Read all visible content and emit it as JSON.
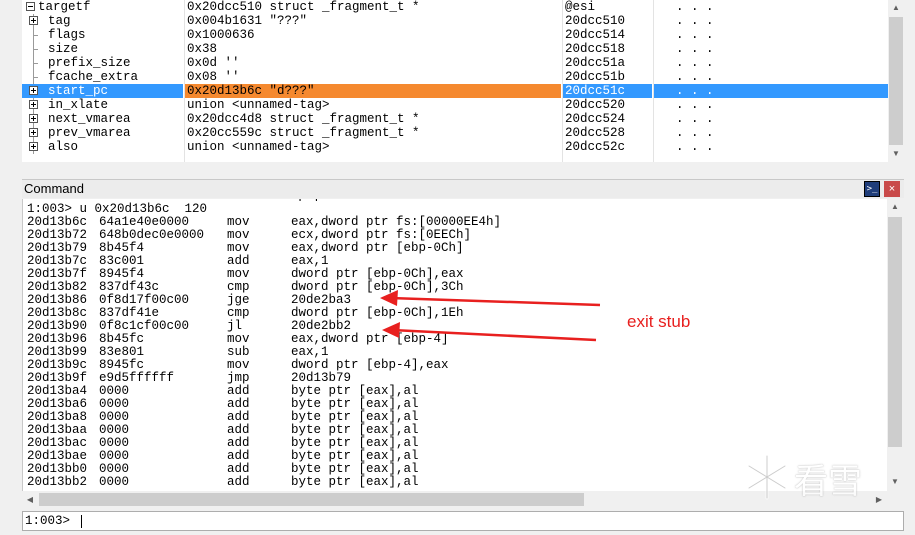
{
  "locals": {
    "rows": [
      {
        "indent": 0,
        "expander": "minus",
        "name": "targetf",
        "value": "0x20dcc510 struct _fragment_t *",
        "location": "@esi",
        "extra": ". . ."
      },
      {
        "indent": 1,
        "expander": "plus",
        "name": "tag",
        "value": "0x004b1631 \"???\"",
        "location": "20dcc510",
        "extra": ". . ."
      },
      {
        "indent": 1,
        "expander": "none",
        "name": "flags",
        "value": "0x1000636",
        "location": "20dcc514",
        "extra": ". . ."
      },
      {
        "indent": 1,
        "expander": "none",
        "name": "size",
        "value": "0x38",
        "location": "20dcc518",
        "extra": ". . ."
      },
      {
        "indent": 1,
        "expander": "none",
        "name": "prefix_size",
        "value": "0x0d ''",
        "location": "20dcc51a",
        "extra": ". . ."
      },
      {
        "indent": 1,
        "expander": "none",
        "name": "fcache_extra",
        "value": "0x08 ''",
        "location": "20dcc51b",
        "extra": ". . ."
      },
      {
        "indent": 1,
        "expander": "plus",
        "name": "start_pc",
        "value": "0x20d13b6c \"d???\"",
        "location": "20dcc51c",
        "extra": ". . .",
        "selected": true
      },
      {
        "indent": 1,
        "expander": "plus",
        "name": "in_xlate",
        "value": "union <unnamed-tag>",
        "location": "20dcc520",
        "extra": ". . ."
      },
      {
        "indent": 1,
        "expander": "plus",
        "name": "next_vmarea",
        "value": "0x20dcc4d8 struct _fragment_t *",
        "location": "20dcc524",
        "extra": ". . ."
      },
      {
        "indent": 1,
        "expander": "plus",
        "name": "prev_vmarea",
        "value": "0x20cc559c struct _fragment_t *",
        "location": "20dcc528",
        "extra": ". . ."
      },
      {
        "indent": 1,
        "expander": "plus",
        "name": "also",
        "value": "union <unnamed-tag>",
        "location": "20dcc52c",
        "extra": ". . ."
      }
    ]
  },
  "command": {
    "title": "Command",
    "console_icon": ">_",
    "close_icon": "×",
    "partial_line": "                                    [ ]",
    "lines": [
      {
        "addr": "1:003> u 0x20d13b6c  120",
        "bytes": "",
        "mnem": "",
        "ops": ""
      },
      {
        "addr": "20d13b6c",
        "bytes": "64a1e40e0000",
        "mnem": "mov",
        "ops": "eax,dword ptr fs:[00000EE4h]"
      },
      {
        "addr": "20d13b72",
        "bytes": "648b0dec0e0000",
        "mnem": "mov",
        "ops": "ecx,dword ptr fs:[0EECh]"
      },
      {
        "addr": "20d13b79",
        "bytes": "8b45f4",
        "mnem": "mov",
        "ops": "eax,dword ptr [ebp-0Ch]"
      },
      {
        "addr": "20d13b7c",
        "bytes": "83c001",
        "mnem": "add",
        "ops": "eax,1"
      },
      {
        "addr": "20d13b7f",
        "bytes": "8945f4",
        "mnem": "mov",
        "ops": "dword ptr [ebp-0Ch],eax"
      },
      {
        "addr": "20d13b82",
        "bytes": "837df43c",
        "mnem": "cmp",
        "ops": "dword ptr [ebp-0Ch],3Ch"
      },
      {
        "addr": "20d13b86",
        "bytes": "0f8d17f00c00",
        "mnem": "jge",
        "ops": "20de2ba3"
      },
      {
        "addr": "20d13b8c",
        "bytes": "837df41e",
        "mnem": "cmp",
        "ops": "dword ptr [ebp-0Ch],1Eh"
      },
      {
        "addr": "20d13b90",
        "bytes": "0f8c1cf00c00",
        "mnem": "jl",
        "ops": "20de2bb2"
      },
      {
        "addr": "20d13b96",
        "bytes": "8b45fc",
        "mnem": "mov",
        "ops": "eax,dword ptr [ebp-4]"
      },
      {
        "addr": "20d13b99",
        "bytes": "83e801",
        "mnem": "sub",
        "ops": "eax,1"
      },
      {
        "addr": "20d13b9c",
        "bytes": "8945fc",
        "mnem": "mov",
        "ops": "dword ptr [ebp-4],eax"
      },
      {
        "addr": "20d13b9f",
        "bytes": "e9d5ffffff",
        "mnem": "jmp",
        "ops": "20d13b79"
      },
      {
        "addr": "20d13ba4",
        "bytes": "0000",
        "mnem": "add",
        "ops": "byte ptr [eax],al"
      },
      {
        "addr": "20d13ba6",
        "bytes": "0000",
        "mnem": "add",
        "ops": "byte ptr [eax],al"
      },
      {
        "addr": "20d13ba8",
        "bytes": "0000",
        "mnem": "add",
        "ops": "byte ptr [eax],al"
      },
      {
        "addr": "20d13baa",
        "bytes": "0000",
        "mnem": "add",
        "ops": "byte ptr [eax],al"
      },
      {
        "addr": "20d13bac",
        "bytes": "0000",
        "mnem": "add",
        "ops": "byte ptr [eax],al"
      },
      {
        "addr": "20d13bae",
        "bytes": "0000",
        "mnem": "add",
        "ops": "byte ptr [eax],al"
      },
      {
        "addr": "20d13bb0",
        "bytes": "0000",
        "mnem": "add",
        "ops": "byte ptr [eax],al"
      },
      {
        "addr": "20d13bb2",
        "bytes": "0000",
        "mnem": "add",
        "ops": "byte ptr [eax],al"
      }
    ],
    "prompt": "1:003>",
    "input_value": ""
  },
  "annotation": {
    "label": "exit stub",
    "color": "#e8201f"
  },
  "watermark": {
    "text": "看雪"
  },
  "colors": {
    "selected_row": "#3399ff",
    "selected_value": "#f5892f"
  }
}
